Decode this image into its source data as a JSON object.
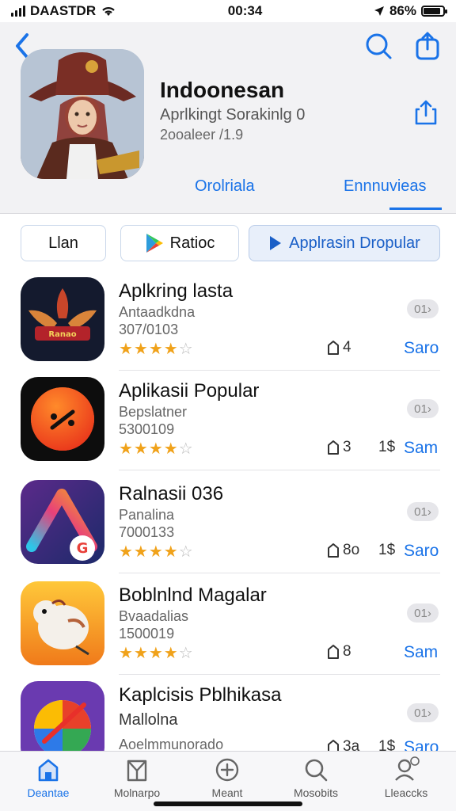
{
  "status": {
    "carrier": "DAASTDR",
    "time": "00:34",
    "battery": "86%",
    "battery_level": 0.86
  },
  "header": {
    "app_title": "Indoonesan",
    "app_subtitle": "Aprlkingt Sorakinlg 0",
    "app_meta": "2ooaleer /1.9",
    "segment_left": "Orolriala",
    "segment_right": "Ennnuvieas"
  },
  "filters": [
    {
      "label": "Llan",
      "active": false
    },
    {
      "label": "Ratioc",
      "active": false
    },
    {
      "label": "Applrasin Dropular",
      "active": true
    }
  ],
  "apps": [
    {
      "name": "Aplkring lasta",
      "sub": "Antaadkdna",
      "sub2": "307/0103",
      "rating": 4.5,
      "badge": "01",
      "downloads": "4",
      "price": "",
      "action": "Saro"
    },
    {
      "name": "Aplikasii Popular",
      "sub": "Bepslatner",
      "sub2": "5300109",
      "rating": 4.5,
      "badge": "01",
      "downloads": "3",
      "price": "1$",
      "action": "Sam"
    },
    {
      "name": "Ralnasii 036",
      "sub": "Panalina",
      "sub2": "7000133",
      "rating": 4.5,
      "badge": "01",
      "downloads": "8o",
      "price": "1$",
      "action": "Saro"
    },
    {
      "name": "Boblnlnd Magalar",
      "sub": "Bvaadalias",
      "sub2": "1500019",
      "rating": 4.5,
      "badge": "01",
      "downloads": "8",
      "price": "",
      "action": "Sam"
    },
    {
      "name": "Kaplcisis Pblhikasa",
      "sub": "Mallolna",
      "sub2": "Aoelmmunorado",
      "rating": 0,
      "badge": "01",
      "downloads": "3a",
      "price": "1$",
      "action": "Saro"
    }
  ],
  "tabbar": [
    {
      "label": "Deantae",
      "icon": "home-icon",
      "active": true
    },
    {
      "label": "Molnarpo",
      "icon": "map-icon",
      "active": false
    },
    {
      "label": "Meant",
      "icon": "add-icon",
      "active": false
    },
    {
      "label": "Mosobits",
      "icon": "search-icon",
      "active": false
    },
    {
      "label": "Lleaccks",
      "icon": "profile-icon",
      "active": false
    }
  ],
  "colors": {
    "accent": "#1a73e8",
    "star": "#f0a21a",
    "header_bg": "#f2f2f4"
  }
}
